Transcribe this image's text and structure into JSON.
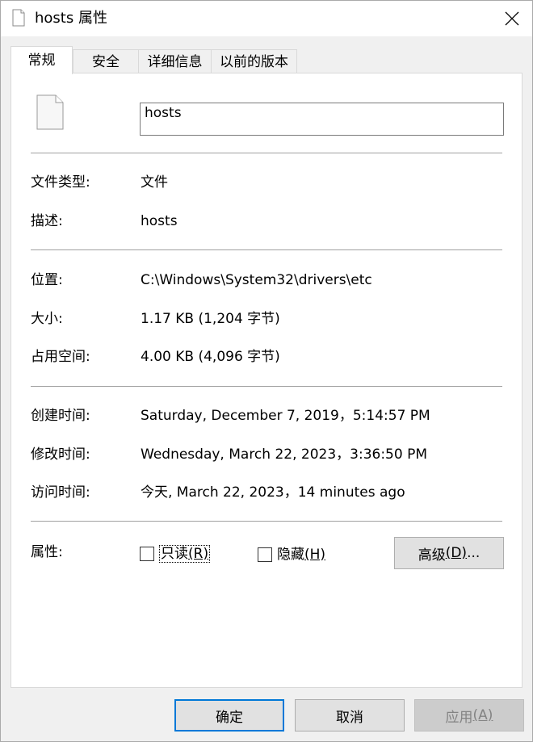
{
  "window": {
    "title": "hosts 属性",
    "close_glyph": "✕"
  },
  "tabs": [
    {
      "label": "常规",
      "active": true
    },
    {
      "label": "安全",
      "active": false
    },
    {
      "label": "详细信息",
      "active": false
    },
    {
      "label": "以前的版本",
      "active": false
    }
  ],
  "general": {
    "file_name": "hosts",
    "file_type": {
      "label": "文件类型:",
      "value": "文件"
    },
    "description": {
      "label": "描述:",
      "value": "hosts"
    },
    "location": {
      "label": "位置:",
      "value": "C:\\Windows\\System32\\drivers\\etc"
    },
    "size": {
      "label": "大小:",
      "value": "1.17 KB (1,204 字节)"
    },
    "size_on_disk": {
      "label": "占用空间:",
      "value": "4.00 KB (4,096 字节)"
    },
    "created": {
      "label": "创建时间:",
      "value": "Saturday, December 7, 2019，5:14:57 PM"
    },
    "modified": {
      "label": "修改时间:",
      "value": "Wednesday, March 22, 2023，3:36:50 PM"
    },
    "accessed": {
      "label": "访问时间:",
      "value": "今天, March 22, 2023，14 minutes ago"
    },
    "attributes": {
      "label": "属性:",
      "readonly": {
        "text": "只读",
        "mnemonic": "(R)",
        "checked": false
      },
      "hidden": {
        "text": "隐藏",
        "mnemonic": "(H)",
        "checked": false
      },
      "advanced": {
        "text": "高级",
        "mnemonic": "(D)",
        "suffix": "..."
      }
    }
  },
  "footer": {
    "ok": "确定",
    "cancel": "取消",
    "apply": {
      "text": "应用",
      "mnemonic": "(A)",
      "disabled": true
    }
  },
  "colors": {
    "accent": "#0078d7",
    "panel_bg": "#ffffff",
    "window_bg": "#f0f0f0"
  }
}
